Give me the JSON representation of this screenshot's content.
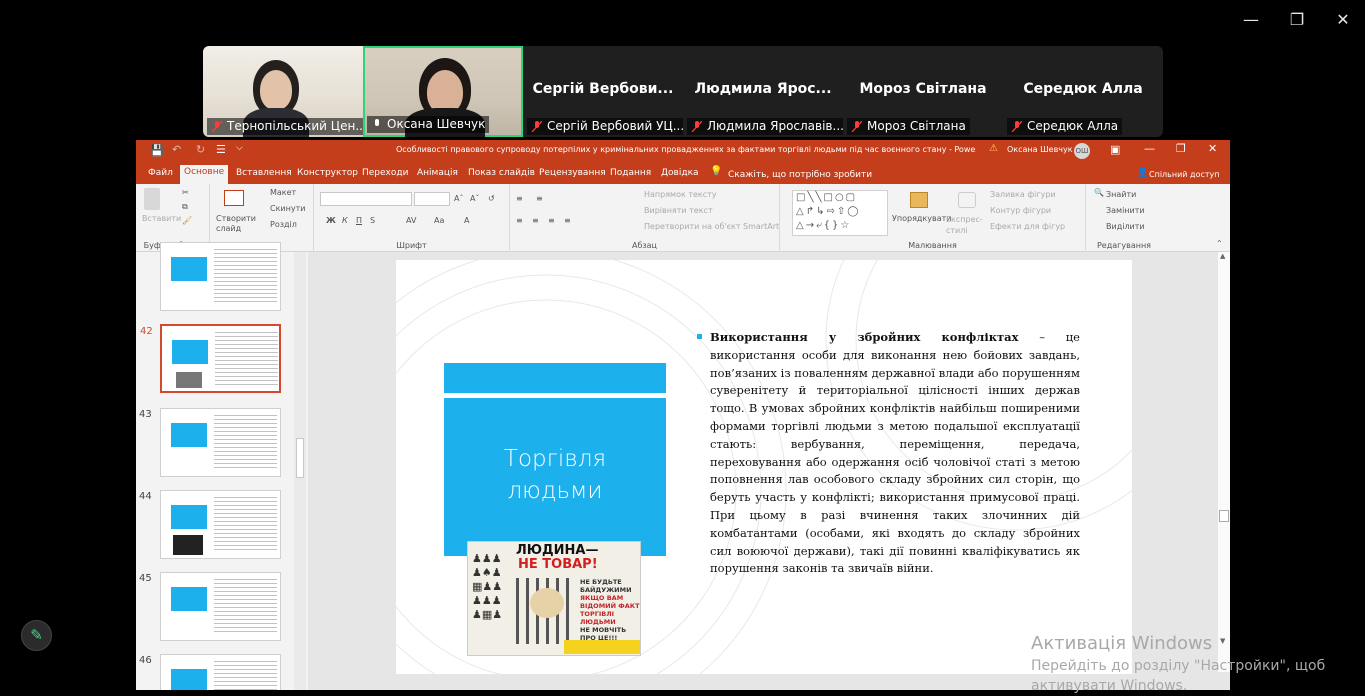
{
  "participants": [
    {
      "name": "Тернопільський Цен...",
      "video": true
    },
    {
      "name": "Оксана Шевчук",
      "video": true,
      "speaking": true
    },
    {
      "display": "Сергій  Вербови...",
      "name": "Сергій Вербовий УЦ..."
    },
    {
      "display": "Людмила  Ярос...",
      "name": "Людмила Ярославів..."
    },
    {
      "display": "Мороз Світлана",
      "name": "Мороз Світлана"
    },
    {
      "display": "Середюк Алла",
      "name": "Середюк Алла"
    }
  ],
  "ppt": {
    "title": "Особливості правового супроводу потерпілих у кримінальних провадженнях за фактами торгівлі людьми під час воєнного стану  -  PowerPoint",
    "user": "Оксана Шевчук",
    "user_initials": "ОШ",
    "tabs": [
      "Файл",
      "Основне",
      "Вставлення",
      "Конструктор",
      "Переходи",
      "Анімація",
      "Показ слайдів",
      "Рецензування",
      "Подання",
      "Довідка"
    ],
    "tell_me": "Скажіть, що потрібно зробити",
    "share": "Спільний доступ",
    "ribbon": {
      "clipboard_group": "Буфер обміну",
      "paste": "Вставити",
      "slides_group": "Слайди",
      "new_slide": "Створити слайд",
      "layout": "Макет",
      "reset": "Скинути",
      "section": "Розділ",
      "font_group": "Шрифт",
      "paragraph_group": "Абзац",
      "text_direction": "Напрямок тексту",
      "align_text": "Вирівняти текст",
      "smartart": "Перетворити на об'єкт SmartArt",
      "drawing_group": "Малювання",
      "arrange": "Упорядкувати",
      "quick_styles": "Експрес-стилі",
      "shape_fill": "Заливка фігури",
      "shape_outline": "Контур фігури",
      "shape_effects": "Ефекти для фігур",
      "editing_group": "Редагування",
      "find": "Знайти",
      "replace": "Замінити",
      "select": "Виділити"
    },
    "thumbs": [
      {
        "num": "",
        "label": "Торгівля людьми"
      },
      {
        "num": "42",
        "label": "Торгівля людьми",
        "selected": true
      },
      {
        "num": "43",
        "label": "Торгівля людьми"
      },
      {
        "num": "44",
        "label": "Торгівля людьми"
      },
      {
        "num": "45",
        "label": "Торгівля людьми"
      },
      {
        "num": "46",
        "label": "Торгівля людьми"
      }
    ],
    "slide": {
      "title_line1": "Торгівля",
      "title_line2": "людьми",
      "poster_title1": "ЛЮДИНА—",
      "poster_title2": "НЕ ТОВАР!",
      "poster_side1": "НЕ БУДЬТЕ",
      "poster_side2": "БАЙДУЖИМИ",
      "poster_side3": "ЯКЩО ВАМ",
      "poster_side4": "ВІДОМИЙ ФАКТ",
      "poster_side5": "ТОРГІВЛІ ЛЮДЬМИ",
      "poster_side6": "НЕ МОВЧІТЬ",
      "poster_side7": "ПРО ЦЕ!!!",
      "text_bold": "Використання у збройних конфліктах",
      "text_rest": " – це використання особи для виконання нею бойових завдань, пов’язаних із поваленням державної влади або порушенням суверенітету й територіальної цілісності інших держав тощо. В умовах збройних конфліктів найбільш поширеними формами торгівлі людьми з метою подальшої експлуатації стають: вербування, переміщення, передача, переховування або одержання осіб чоловічої статі з метою поповнення лав особового складу збройних сил сторін, що беруть участь у конфлікті; використання примусової праці. При цьому в разі вчинення таких злочинних дій комбатантами (особами, які входять до складу збройних сил воюючої держави), такі дії повинні кваліфікуватись як порушення законів та звичаїв війни."
    }
  },
  "activation": {
    "title": "Активація Windows",
    "subtitle": "Перейдіть до розділу \"Настройки\", щоб",
    "subtitle2": "активувати Windows."
  },
  "colors": {
    "ppt_accent": "#c43e1c",
    "slide_blue": "#1cb1ec",
    "speaking_border": "#2bd67b"
  }
}
